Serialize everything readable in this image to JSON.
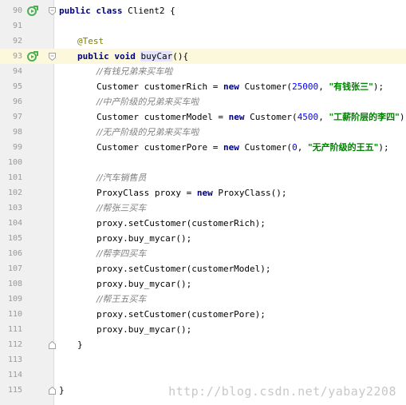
{
  "line_numbers": [
    "90",
    "91",
    "92",
    "93",
    "94",
    "95",
    "96",
    "97",
    "98",
    "99",
    "100",
    "101",
    "102",
    "103",
    "104",
    "105",
    "106",
    "107",
    "108",
    "109",
    "110",
    "111",
    "112",
    "113",
    "114",
    "115"
  ],
  "code": {
    "l90_kw": "public class ",
    "l90_rest": "Client2 {",
    "l92_ann": "@Test",
    "l93_kw": "public void ",
    "l93_name": "buyCar",
    "l93_rest": "(){",
    "l94_c": "//有钱兄弟来买车啦",
    "l95_a": "Customer customerRich = ",
    "l95_kw": "new ",
    "l95_b": "Customer(",
    "l95_num": "25000",
    "l95_c": ", ",
    "l95_str": "\"有钱张三\"",
    "l95_d": ");",
    "l96_c": "//中产阶级的兄弟来买车啦",
    "l97_a": "Customer customerModel = ",
    "l97_kw": "new ",
    "l97_b": "Customer(",
    "l97_num": "4500",
    "l97_c": ", ",
    "l97_str": "\"工薪阶层的李四\"",
    "l97_d": ");",
    "l98_c": "//无产阶级的兄弟来买车啦",
    "l99_a": "Customer customerPore = ",
    "l99_kw": "new ",
    "l99_b": "Customer(",
    "l99_num": "0",
    "l99_c": ", ",
    "l99_str": "\"无产阶级的王五\"",
    "l99_d": ");",
    "l101_c": "//汽车销售员",
    "l102_a": "ProxyClass proxy = ",
    "l102_kw": "new ",
    "l102_b": "ProxyClass();",
    "l103_c": "//帮张三买车",
    "l104": "proxy.setCustomer(customerRich);",
    "l105": "proxy.buy_mycar();",
    "l106_c": "//帮李四买车",
    "l107": "proxy.setCustomer(customerModel);",
    "l108": "proxy.buy_mycar();",
    "l109_c": "//帮王五买车",
    "l110": "proxy.setCustomer(customerPore);",
    "l111": "proxy.buy_mycar();",
    "l112": "}",
    "l115": "}"
  },
  "watermark": "http://blog.csdn.net/yabay2208",
  "colors": {
    "keyword": "#000080",
    "comment": "#808080",
    "number": "#0000ff",
    "string": "#008000",
    "annotation": "#808000",
    "run_icon": "#4caf50"
  },
  "icons": [
    "run-icon",
    "fold-marker-icon"
  ]
}
